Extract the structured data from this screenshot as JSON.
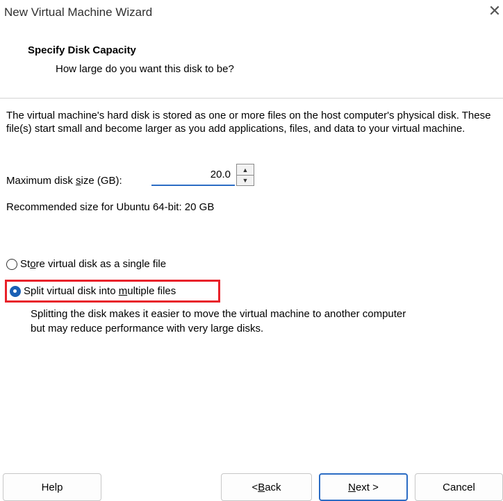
{
  "window": {
    "title": "New Virtual Machine Wizard",
    "close_glyph": "✕"
  },
  "header": {
    "title": "Specify Disk Capacity",
    "subtitle": "How large do you want this disk to be?"
  },
  "main": {
    "description": "The virtual machine's hard disk is stored as one or more files on the host computer's physical disk. These file(s) start small and become larger as you add applications, files, and data to your virtual machine.",
    "disk_size": {
      "label_before": "Maximum disk ",
      "label_accel": "s",
      "label_after": "ize (GB):",
      "value": "20.0"
    },
    "recommended": "Recommended size for Ubuntu 64-bit: 20 GB",
    "options": {
      "single": {
        "before": "St",
        "accel": "o",
        "after": "re virtual disk as a single file",
        "checked": false
      },
      "split": {
        "before": "Split virtual disk into ",
        "accel": "m",
        "after": "ultiple files",
        "checked": true
      }
    },
    "split_description_line1": "Splitting the disk makes it easier to move the virtual machine to another computer",
    "split_description_line2": "but may reduce performance with very large disks."
  },
  "footer": {
    "help": "Help",
    "back_prefix": "< ",
    "back_accel": "B",
    "back_rest": "ack",
    "next_accel": "N",
    "next_rest": "ext >",
    "cancel": "Cancel"
  },
  "colors": {
    "accent": "#2b6cc4",
    "highlight_box": "#e8212a",
    "radio_selected": "#1a5fb4"
  }
}
